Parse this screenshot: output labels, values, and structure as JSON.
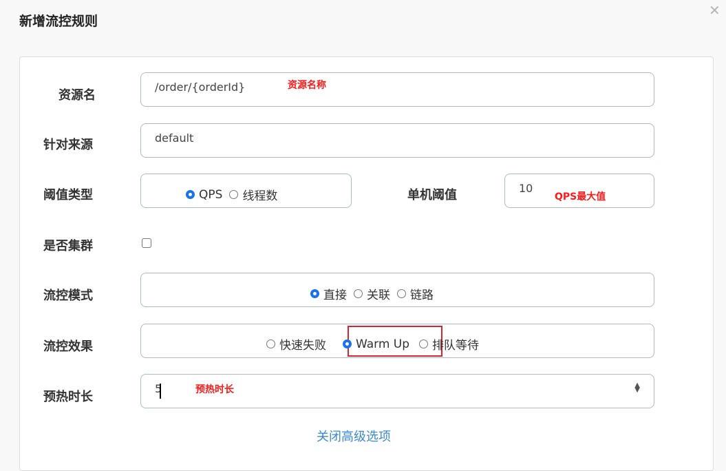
{
  "dialog": {
    "title": "新增流控规则"
  },
  "form": {
    "resource": {
      "label": "资源名",
      "value": "/order/{orderId}",
      "annotation": "资源名称"
    },
    "limit_app": {
      "label": "针对来源",
      "value": "default"
    },
    "grade": {
      "label": "阈值类型",
      "options": [
        "QPS",
        "线程数"
      ],
      "selected": "QPS"
    },
    "threshold": {
      "label": "单机阈值",
      "value": "10",
      "annotation": "QPS最大值"
    },
    "cluster": {
      "label": "是否集群",
      "checked": false
    },
    "strategy": {
      "label": "流控模式",
      "options": [
        "直接",
        "关联",
        "链路"
      ],
      "selected": "直接"
    },
    "control_behavior": {
      "label": "流控效果",
      "options": [
        "快速失败",
        "Warm Up",
        "排队等待"
      ],
      "selected": "Warm Up"
    },
    "warmup": {
      "label": "预热时长",
      "value": "5",
      "annotation": "预热时长"
    }
  },
  "advanced_link": "关闭高级选项"
}
